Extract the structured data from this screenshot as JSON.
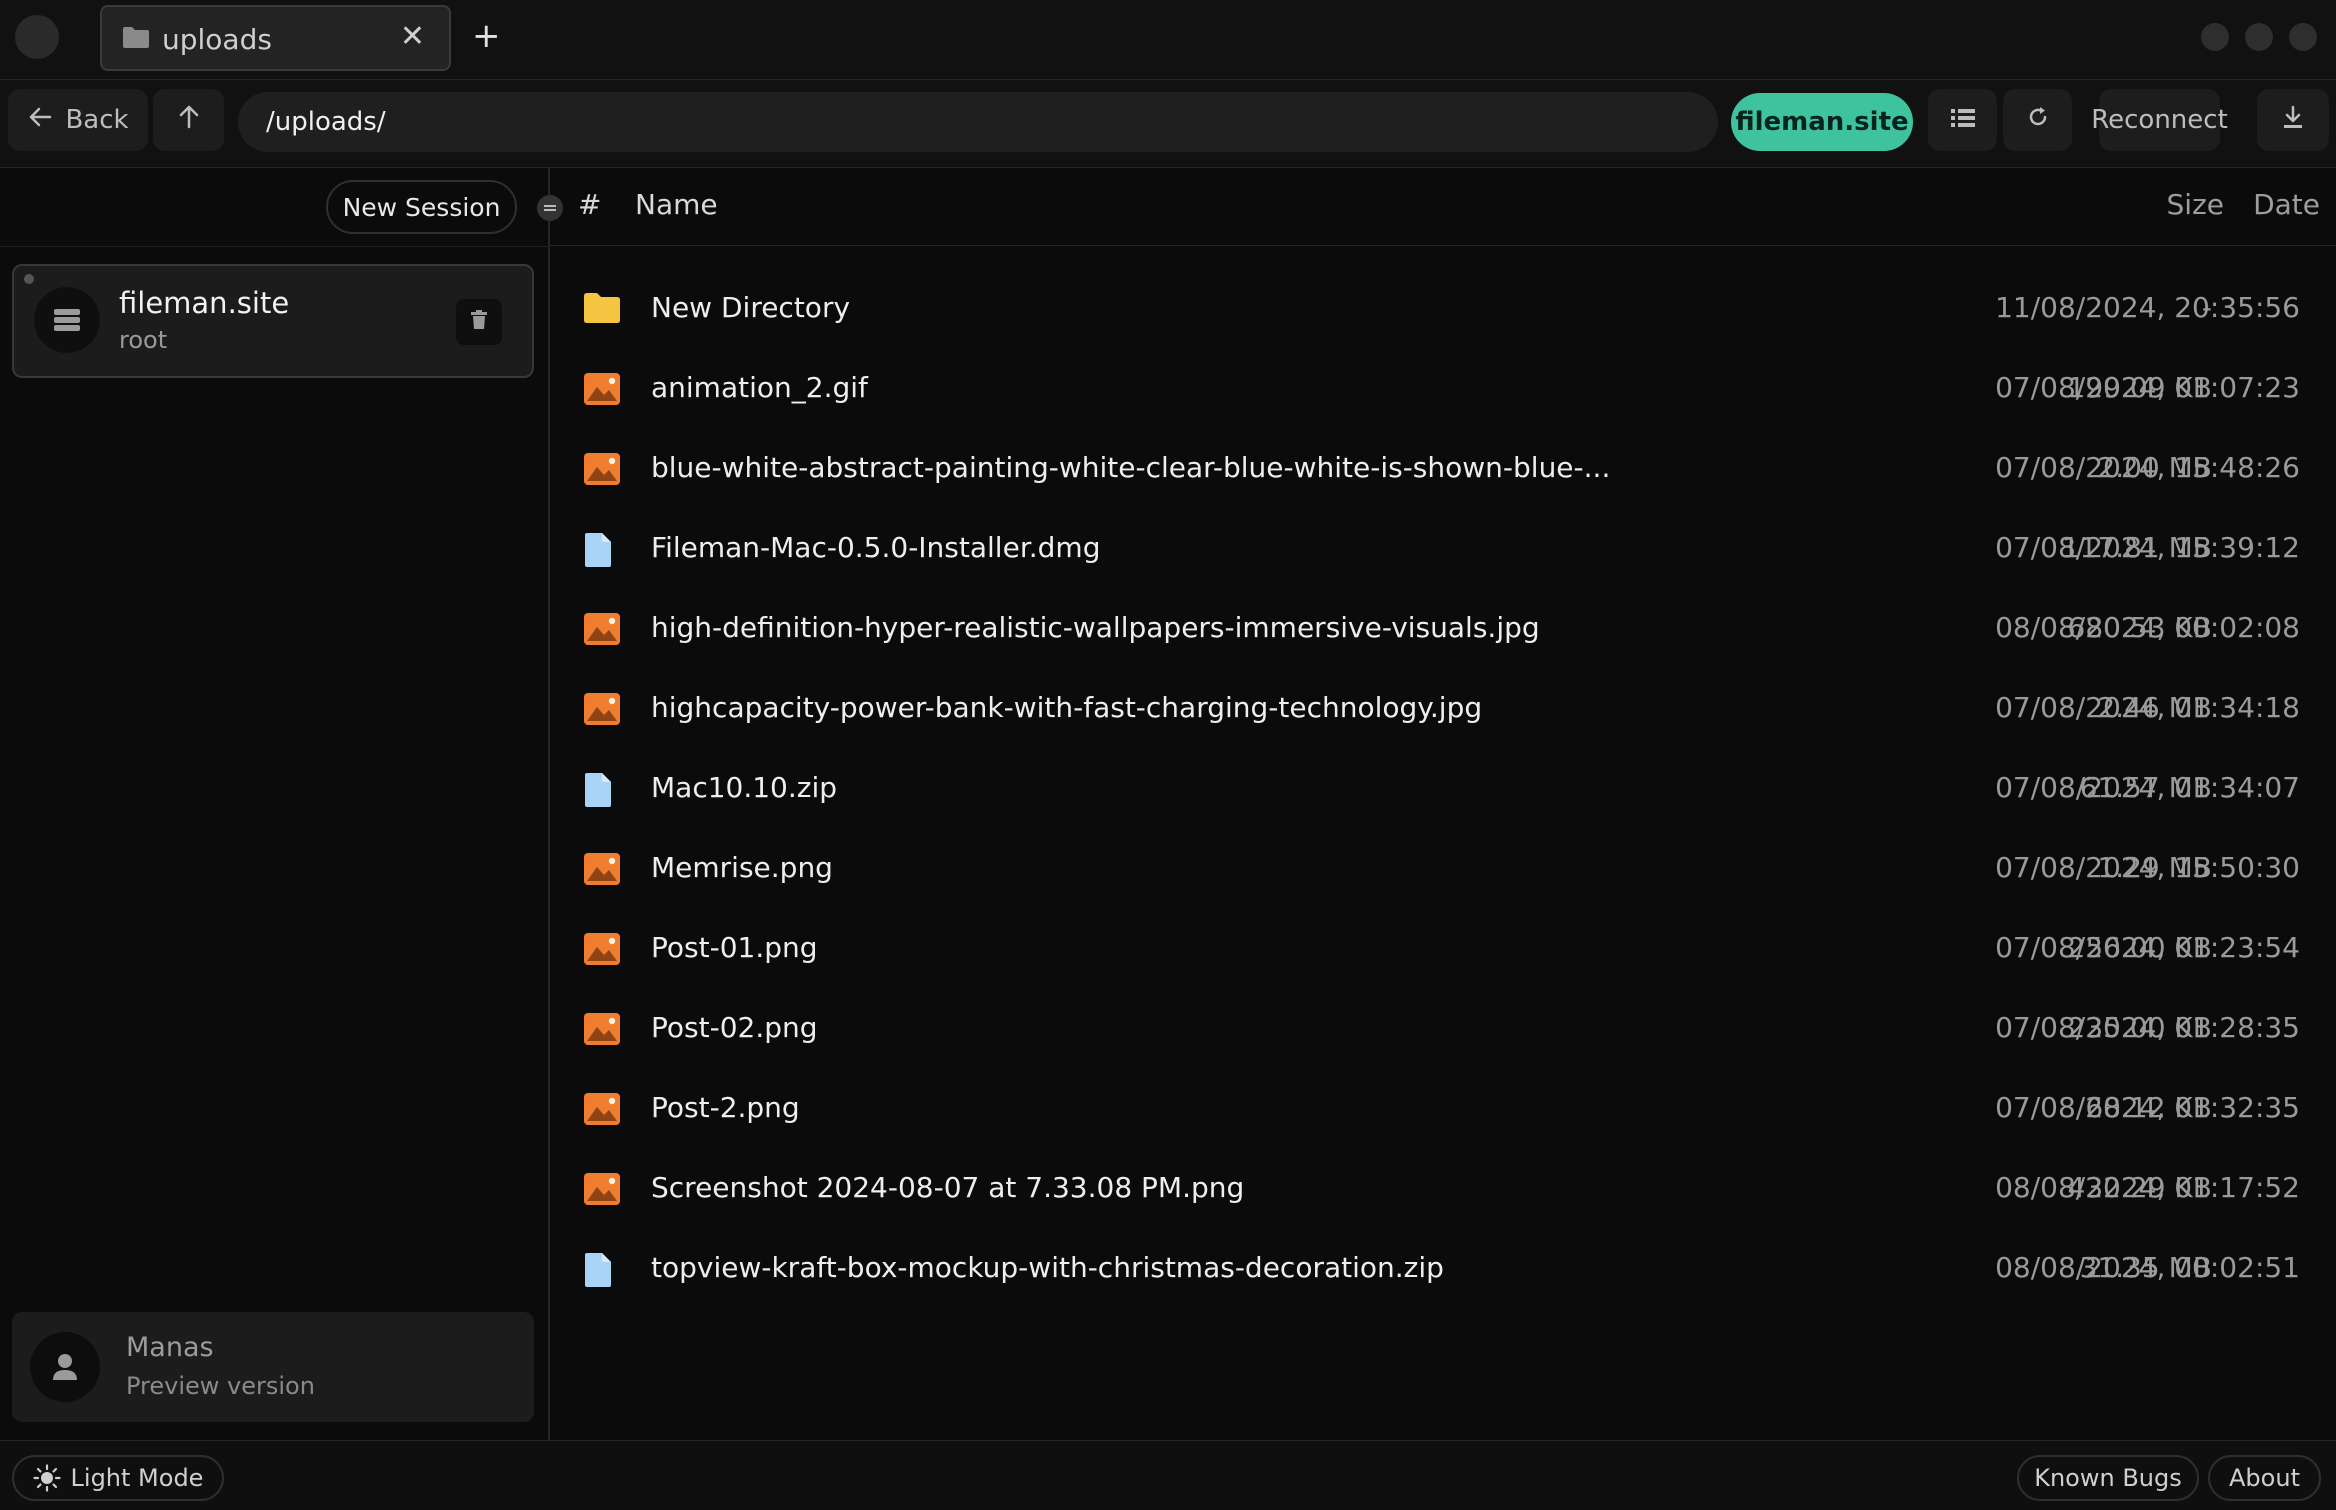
{
  "tab": {
    "title": "uploads",
    "icon": "folder-icon"
  },
  "toolbar": {
    "back_label": "Back",
    "path": "/uploads/",
    "server": "fileman.site",
    "reconnect_label": "Reconnect"
  },
  "sidebar": {
    "new_session_label": "New Session",
    "session": {
      "name": "fileman.site",
      "user": "root"
    },
    "user": {
      "name": "Manas",
      "subtitle": "Preview version"
    }
  },
  "columns": {
    "index": "#",
    "name": "Name",
    "size": "Size",
    "date": "Date"
  },
  "files": [
    {
      "name": "New Directory",
      "size": "-",
      "date": "11/08/2024, 20:35:56",
      "type": "folder"
    },
    {
      "name": "animation_2.gif",
      "size": "199.09 KB",
      "date": "07/08/2024, 01:07:23",
      "type": "image"
    },
    {
      "name": "blue-white-abstract-painting-white-clear-blue-white-is-shown-blue-...",
      "size": "2.00 MB",
      "date": "07/08/2024, 15:48:26",
      "type": "image"
    },
    {
      "name": "Fileman-Mac-0.5.0-Installer.dmg",
      "size": "117.81 MB",
      "date": "07/08/2024, 15:39:12",
      "type": "file"
    },
    {
      "name": "high-definition-hyper-realistic-wallpapers-immersive-visuals.jpg",
      "size": "680.53 KB",
      "date": "08/08/2024, 00:02:08",
      "type": "image"
    },
    {
      "name": "highcapacity-power-bank-with-fast-charging-technology.jpg",
      "size": "2.46 MB",
      "date": "07/08/2024, 01:34:18",
      "type": "image"
    },
    {
      "name": "Mac10.10.zip",
      "size": "61.57 MB",
      "date": "07/08/2024, 01:34:07",
      "type": "file"
    },
    {
      "name": "Memrise.png",
      "size": "1.29 MB",
      "date": "07/08/2024, 15:50:30",
      "type": "image"
    },
    {
      "name": "Post-01.png",
      "size": "256.00 KB",
      "date": "07/08/2024, 01:23:54",
      "type": "image"
    },
    {
      "name": "Post-02.png",
      "size": "235.00 KB",
      "date": "07/08/2024, 01:28:35",
      "type": "image"
    },
    {
      "name": "Post-2.png",
      "size": "68.12 KB",
      "date": "07/08/2024, 01:32:35",
      "type": "image"
    },
    {
      "name": "Screenshot 2024-08-07 at 7.33.08 PM.png",
      "size": "432.29 KB",
      "date": "08/08/2024, 01:17:52",
      "type": "image"
    },
    {
      "name": "topview-kraft-box-mockup-with-christmas-decoration.zip",
      "size": "31.35 MB",
      "date": "08/08/2024, 00:02:51",
      "type": "file"
    }
  ],
  "footer": {
    "light_mode_label": "Light Mode",
    "known_bugs_label": "Known Bugs",
    "about_label": "About"
  },
  "colors": {
    "accent": "#3fc29e",
    "folder": "#f5c542",
    "image": "#ef7d2d",
    "file": "#a8d4f5"
  }
}
